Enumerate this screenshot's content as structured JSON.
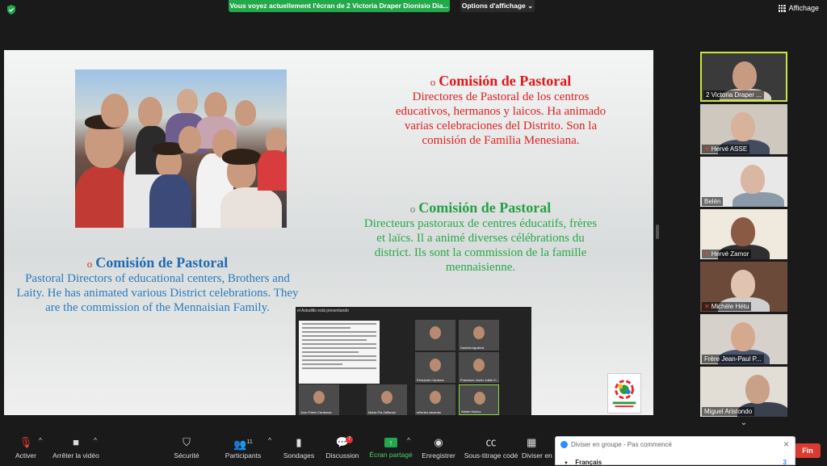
{
  "topbar": {
    "share_banner": "Vous voyez actuellement l'écran de 2 Victoria Draper Dionisio Dia...",
    "view_options": "Options d'affichage ⌄",
    "display_label": "Affichage"
  },
  "slide": {
    "es": {
      "heading": "Comisión de Pastoral",
      "body": "Directores de Pastoral de los centros educativos, hermanos y laicos. Ha animado varias celebraciones del Distrito. Son la comisión de Familia Menesiana."
    },
    "fr": {
      "heading": "Comisión de Pastoral",
      "body": "Directeurs pastoraux de centres éducatifs, frères et laïcs. Il a animé diverses célébrations du district. Ils sont la commission de la famille mennaisienne."
    },
    "en": {
      "heading": "Comisión de Pastoral",
      "body": "Pastoral Directors of educational centers, Brothers and Laity. He has animated various District celebrations. They are the commission of the Mennaisian Family."
    },
    "bullet": "o",
    "inner_screenshot": {
      "title": "el Astudillo está presentando",
      "tiles": [
        "Daniela Aguilera",
        "Fernando Cardona",
        "Francisco Javier Julián C...",
        "Juan Pablo Cárdenas",
        "María Pía Zaffaroni",
        "milenka zacarías",
        "Walter Muñoz"
      ]
    }
  },
  "participants": [
    {
      "name": "2 Victoria Draper ...",
      "muted": false,
      "active": true
    },
    {
      "name": "Hervé ASSE",
      "muted": true,
      "active": false
    },
    {
      "name": "Belén",
      "muted": false,
      "active": false
    },
    {
      "name": "Hervé Zamor",
      "muted": true,
      "active": false
    },
    {
      "name": "Michèle Hétu",
      "muted": true,
      "active": false
    },
    {
      "name": "Frère Jean-Paul P...",
      "muted": false,
      "active": false
    },
    {
      "name": "Miguel Aristondo",
      "muted": false,
      "active": false
    }
  ],
  "toolbar": {
    "activate": "Activer",
    "stop_video": "Arrêter la vidéo",
    "security": "Sécurité",
    "participants": "Participants",
    "participants_count": "11",
    "polls": "Sondages",
    "chat": "Discussion",
    "chat_badge": "7",
    "share_screen": "Écran partagé",
    "record": "Enregistrer",
    "subtitles": "Sous-titrage codé",
    "breakout": "Diviser en",
    "end": "Fin"
  },
  "breakout_popup": {
    "title": "Diviser en groupe - Pas commencé",
    "row_label": "Français",
    "row_count": "3"
  },
  "colors": {
    "share_green": "#23a84b",
    "active_border": "#c8e63e",
    "end_red": "#d93a31",
    "spanish_red": "#e01818",
    "french_green": "#25a045",
    "english_blue": "#1f6cb3"
  }
}
